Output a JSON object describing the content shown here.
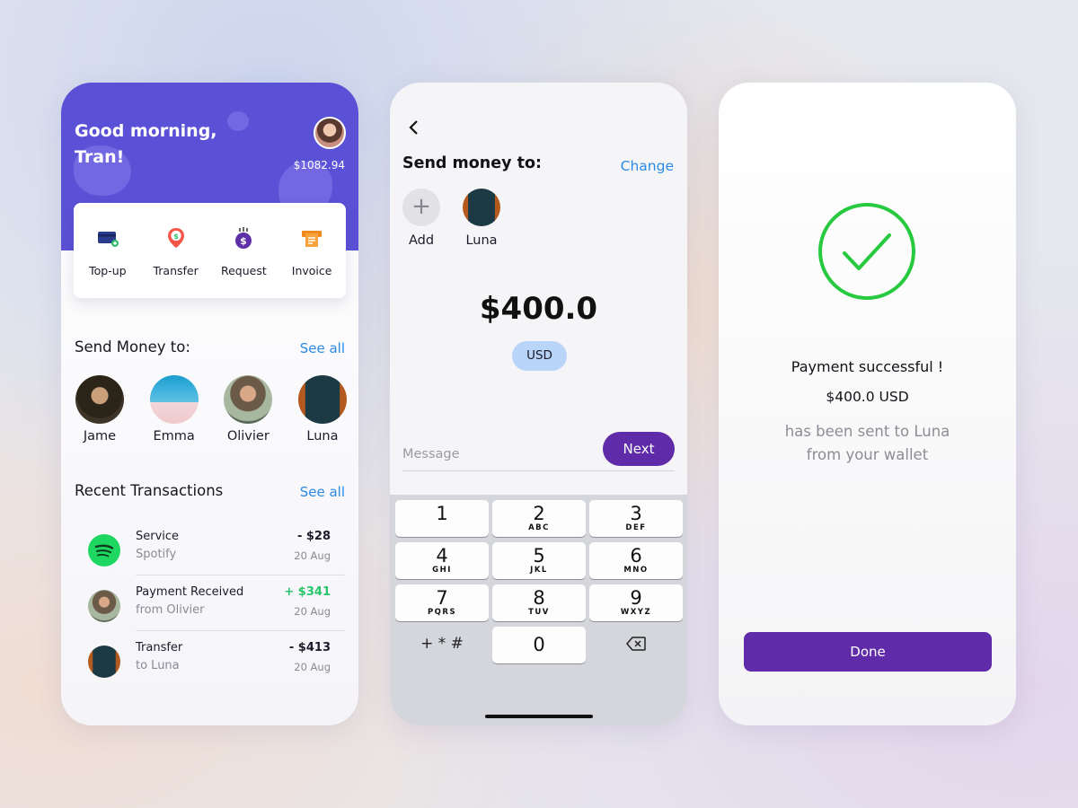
{
  "home": {
    "greeting": "Good morning, Tran!",
    "balance": "$1082.94",
    "actions": [
      {
        "label": "Top-up",
        "icon": "card-add-icon"
      },
      {
        "label": "Transfer",
        "icon": "dollar-pin-icon"
      },
      {
        "label": "Request",
        "icon": "dollar-coin-icon"
      },
      {
        "label": "Invoice",
        "icon": "receipt-icon"
      }
    ],
    "send_title": "Send Money to:",
    "send_see_all": "See all",
    "contacts": [
      "Jame",
      "Emma",
      "Olivier",
      "Luna"
    ],
    "recent_title": "Recent Transactions",
    "recent_see_all": "See all",
    "transactions": [
      {
        "title": "Service",
        "subtitle": "Spotify",
        "amount": "- $28",
        "date": "20 Aug",
        "positive": false
      },
      {
        "title": "Payment Received",
        "subtitle": "from Olivier",
        "amount": "+ $341",
        "date": "20 Aug",
        "positive": true
      },
      {
        "title": "Transfer",
        "subtitle": "to Luna",
        "amount": "- $413",
        "date": "20 Aug",
        "positive": false
      }
    ]
  },
  "send": {
    "title": "Send money to:",
    "change": "Change",
    "add_label": "Add",
    "recipient": "Luna",
    "amount": "$400.0",
    "currency": "USD",
    "message_placeholder": "Message",
    "next": "Next",
    "keys": [
      {
        "num": "1",
        "sub": ""
      },
      {
        "num": "2",
        "sub": "ABC"
      },
      {
        "num": "3",
        "sub": "DEF"
      },
      {
        "num": "4",
        "sub": "GHI"
      },
      {
        "num": "5",
        "sub": "JKL"
      },
      {
        "num": "6",
        "sub": "MNO"
      },
      {
        "num": "7",
        "sub": "PQRS"
      },
      {
        "num": "8",
        "sub": "TUV"
      },
      {
        "num": "9",
        "sub": "WXYZ"
      }
    ],
    "symbols_key": "+ * #",
    "zero_key": "0"
  },
  "success": {
    "title": "Payment successful !",
    "amount": "$400.0 USD",
    "note_line1": "has been sent to Luna",
    "note_line2": "from your wallet",
    "done": "Done"
  },
  "colors": {
    "header_purple": "#5b51d6",
    "button_purple": "#5f2ba8",
    "link_blue": "#2b8ae8",
    "success_green": "#27c93f",
    "positive_green": "#27c46a",
    "pill_blue": "#b9d4f9"
  }
}
